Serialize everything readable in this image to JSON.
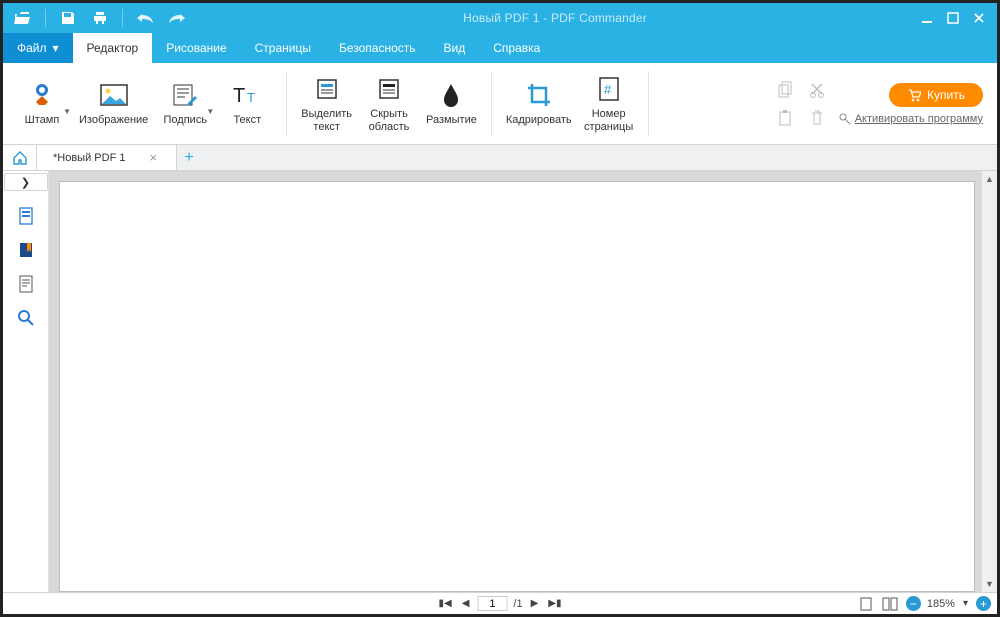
{
  "window": {
    "title": "Новый PDF 1 - PDF Commander"
  },
  "menu": {
    "file": "Файл",
    "tabs": [
      "Редактор",
      "Рисование",
      "Страницы",
      "Безопасность",
      "Вид",
      "Справка"
    ],
    "active_index": 0
  },
  "ribbon": {
    "tools": {
      "stamp": "Штамп",
      "image": "Изображение",
      "signature": "Подпись",
      "text": "Текст",
      "highlight": "Выделить\nтекст",
      "hide_area": "Скрыть\nобласть",
      "blur": "Размытие",
      "crop": "Кадрировать",
      "page_number": "Номер\nстраницы"
    },
    "buy": "Купить",
    "activate": "Активировать программу"
  },
  "tabs": {
    "doc1": "*Новый PDF 1"
  },
  "status": {
    "page_current": "1",
    "page_total": "/1",
    "zoom": "185%"
  }
}
